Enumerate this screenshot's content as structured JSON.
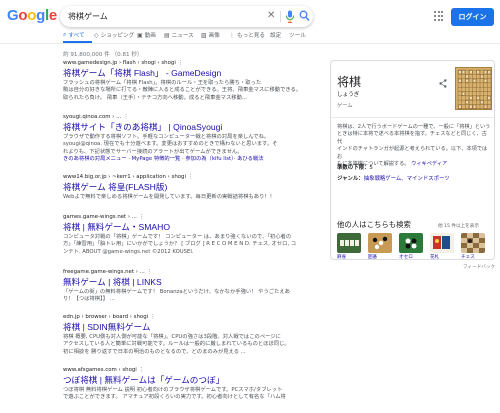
{
  "logo": {
    "letters": [
      "G",
      "o",
      "o",
      "g",
      "l",
      "e"
    ],
    "colors": [
      "#4285f4",
      "#ea4335",
      "#fbbc05",
      "#4285f4",
      "#34a853",
      "#ea4335"
    ]
  },
  "search": {
    "query": "将棋ゲーム"
  },
  "header": {
    "login_label": "ログイン"
  },
  "tabs": [
    {
      "label": "すべて",
      "icon": "search-icon"
    },
    {
      "label": "ショッピング",
      "icon": "tag-icon"
    },
    {
      "label": "動画",
      "icon": "video-icon"
    },
    {
      "label": "ニュース",
      "icon": "news-icon"
    },
    {
      "label": "画像",
      "icon": "image-icon"
    },
    {
      "label": "もっと見る",
      "icon": "more-icon"
    },
    {
      "label": "設定",
      "icon": ""
    },
    {
      "label": "ツール",
      "icon": ""
    }
  ],
  "stats": "約 91,800,000 件 （0.81 秒）",
  "results": [
    {
      "url": "www.gamedesign.jp › flash › shogi › shogi",
      "title": "将棋ゲーム「将棋 Flash」 - GameDesign",
      "snippet": [
        "フラッシュの将棋ゲーム「将棋 Flash」。将棋のルール・王を取ったら勝ち・取った",
        "駒は自分の好きな場所に打てる・敵陣に入ると成ることができる。王将、飛車金マスに移動できる。",
        "取られたら負け。 飛車（王手）・テチコ方向へ移動。成ると飛車金マス移動..."
      ]
    },
    {
      "url": "syougi.qinoa.com › ...",
      "title": "将棋サイト「きのあ将棋」 | QinoaSyougi",
      "snippet": [
        "ブラウザで動作する将棋ソフト。手軽なコンピューター戦と将棋の対局を楽しんでね。",
        "syougi@qinoa. 現在でも十分遊べます。変更はおすすめのときで構わないと思います。そ",
        "れよりも、下記状態でサーバー接続のアラートが出てゲームができません。"
      ],
      "links": "きのあ将棋の対局メニュー · MyPage 特徴的一覧 · 参加の為（kifu list）· あひる戦法"
    },
    {
      "url": "www14.big.or.jp › ~kerr1 › application › shogi",
      "title": "将棋ゲーム 将皇(FLASH版)",
      "snippet": [
        "Webよで無料で楽しめる将棋ゲームを開発しています。毎日更新の実戦詰将棋もあり！！"
      ]
    },
    {
      "url": "games.game-wings.net › ...",
      "title": "将棋 | 無料ゲーム・SMAHO",
      "snippet": [
        "コンピュータ対戦の「将棋」ゲームです！ コンピューター は、あまり強くないので、「初心者の",
        "方」「練習用」「脳トレ用」にいかがでしょうか？ [ ブログ ] R E C O M E N D. チェス, オセロ, コ",
        "ンテト. ABOUT @game-wings.net ©2012 KOUSEI."
      ]
    },
    {
      "url": "freegame.game-wings.net › ...",
      "title": "無料ゲーム | 将棋 | LINKS",
      "snippet": [
        "「ゲームの街」の無料将棋ゲームです！ Bonanzaというだけ、なかなか手強い！ やうごたえあ",
        "り！【つば将棋】】 ..."
      ]
    },
    {
      "url": "edn.jp › browser › board › shogi",
      "title": "将棋 | SDIN無料ゲーム",
      "snippet": [
        "将棋 概要, CPU側も対人側が可能な「将棋」。CPUの強さは3段階。対人戦ではこのページに",
        "アクセスしている人と簡単に対戦可能です。ルールは一般的に厳しまれているものとほぼ同じ。",
        "初に相談を 勝り返すで日本の明治のものとなるので、どのまのみが見える ..."
      ]
    },
    {
      "url": "www.afsgames.com › shogi",
      "title": "つぼ将棋 | 無料ゲームは「ゲームのつぼ」",
      "snippet": [
        "つぼ将棋 無料将棋ゲーム 説明 初心者向けのブラウザ将棋ゲームです。PCスマホ/タブレット",
        "で遊ぶことができます。 アマチュア初段くらいの実力です。初心者向けとして有名な「ハム将"
      ]
    }
  ],
  "knowledge_panel": {
    "title": "将棋",
    "reading": "しょうぎ",
    "type": "ゲーム",
    "description": [
      "将棋は、2人で行うボードゲームの一種で、一般に「将棋」という",
      "ときは特に本将で述べる本将棋を指す。チェスなどと同じく、古代",
      "インドのチャトランガが起源と考えられている。以下、本項ではお",
      "もに本将棋について解説する。"
    ],
    "source_link": "ウィキペディア",
    "facts": [
      {
        "label": "準数の下限：",
        "value": "5",
        "link": false
      },
      {
        "label": "ジャンル：",
        "value": "抽象戦略ゲーム、マインドスポーツ",
        "link": true
      }
    ],
    "others_title": "他の人はこちらも検索",
    "more_label": "他 15 件以上を表示",
    "others": [
      "麻雀",
      "囲碁",
      "オセロ",
      "花札",
      "チェス"
    ]
  },
  "feedback_label": "フィードバック"
}
